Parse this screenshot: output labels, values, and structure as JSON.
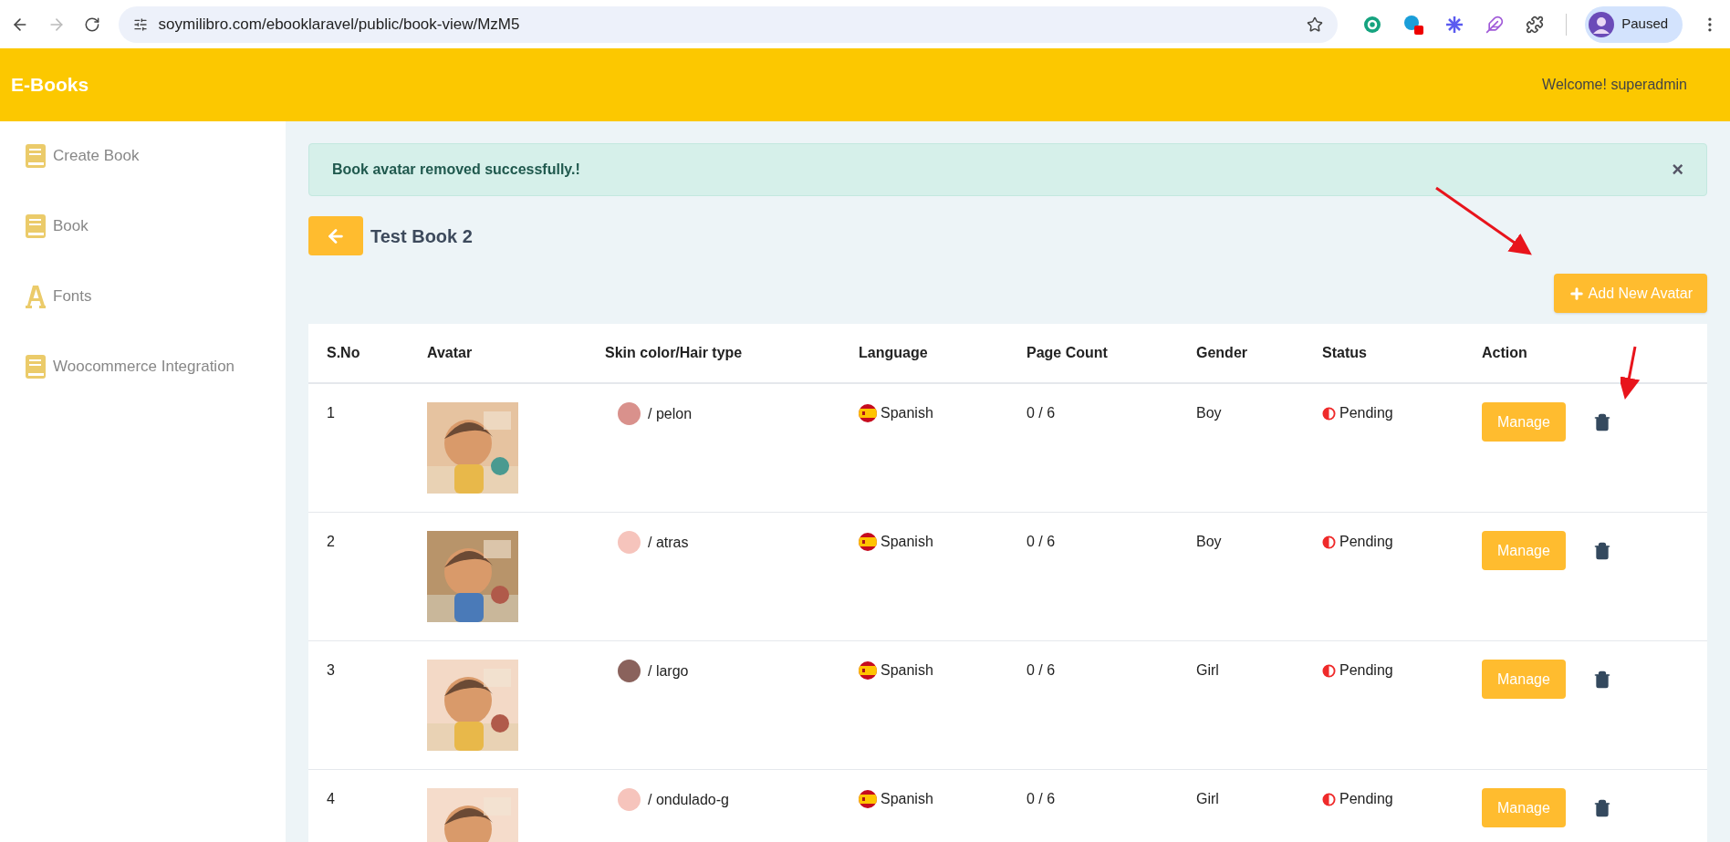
{
  "browser": {
    "url": "soymilibro.com/ebooklaravel/public/book-view/MzM5",
    "forward_disabled": true,
    "profile": "Paused"
  },
  "header": {
    "brand": "E-Books",
    "welcome": "Welcome! superadmin"
  },
  "sidebar": {
    "items": [
      {
        "label": "Create Book",
        "kind": "book"
      },
      {
        "label": "Book",
        "kind": "book"
      },
      {
        "label": "Fonts",
        "kind": "font"
      },
      {
        "label": "Woocommerce Integration",
        "kind": "book"
      }
    ]
  },
  "alert": {
    "message": "Book avatar removed successfully.!",
    "close": "×"
  },
  "page": {
    "title": "Test Book 2",
    "add_button": "Add New Avatar"
  },
  "table": {
    "columns": [
      "S.No",
      "Avatar",
      "Skin color/Hair type",
      "Language",
      "Page Count",
      "Gender",
      "Status",
      "Action"
    ],
    "rows": [
      {
        "sno": "1",
        "color": "#d9918c",
        "hair": "/ pelon",
        "language": "Spanish",
        "pages": "0 / 6",
        "gender": "Boy",
        "status": "Pending",
        "action": "Manage"
      },
      {
        "sno": "2",
        "color": "#f6c4bc",
        "hair": "/ atras",
        "language": "Spanish",
        "pages": "0 / 6",
        "gender": "Boy",
        "status": "Pending",
        "action": "Manage"
      },
      {
        "sno": "3",
        "color": "#8a625c",
        "hair": "/ largo",
        "language": "Spanish",
        "pages": "0 / 6",
        "gender": "Girl",
        "status": "Pending",
        "action": "Manage"
      },
      {
        "sno": "4",
        "color": "#f6c4bc",
        "hair": "/ ondulado-g",
        "language": "Spanish",
        "pages": "0 / 6",
        "gender": "Girl",
        "status": "Pending",
        "action": "Manage"
      }
    ]
  }
}
